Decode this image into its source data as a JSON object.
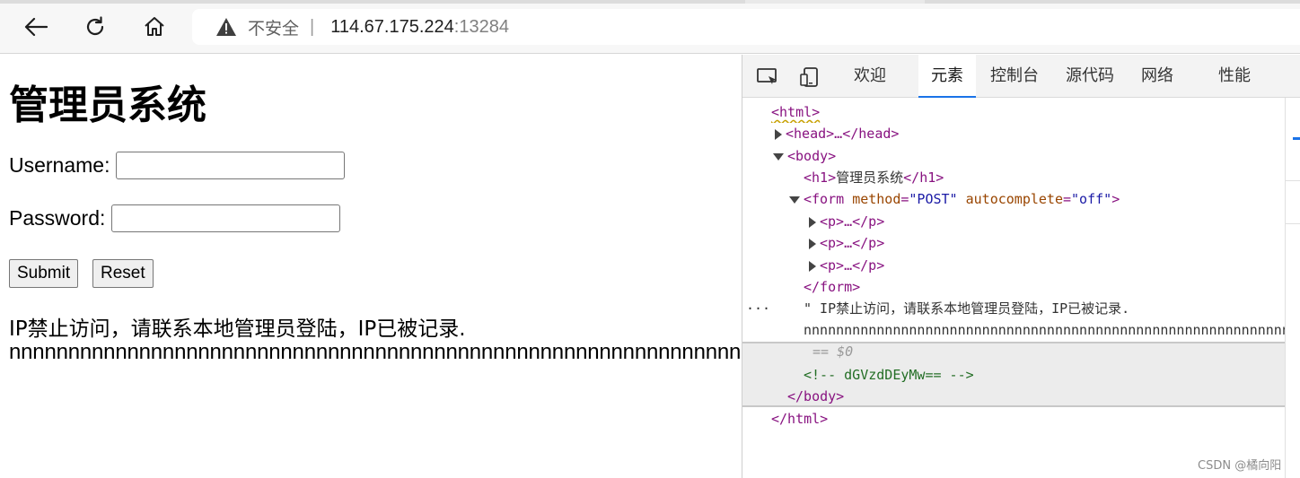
{
  "browser": {
    "insecure_label": "不安全",
    "separator": "|",
    "url_host": "114.67.175.224",
    "url_port": ":13284"
  },
  "page": {
    "heading": "管理员系统",
    "username_label": "Username:",
    "password_label": "Password:",
    "submit_label": "Submit",
    "reset_label": "Reset",
    "message": "IP禁止访问，请联系本地管理员登陆，IP已被记录.",
    "n_line": "nnnnnnnnnnnnnnnnnnnnnnnnnnnnnnnnnnnnnnnnnnnnnnnnnnnnnnnnnnnnnnnnnnnnnnnnnnnnnnnnnnnnnnnnnnnnnnnnnnnnnnnnnnnnnnnnnnnnn"
  },
  "devtools": {
    "tabs": [
      "欢迎",
      "元素",
      "控制台",
      "源代码",
      "网络",
      "性能"
    ],
    "active_tab": "元素",
    "tree": {
      "html_open": "<html>",
      "head": "<head>…</head>",
      "body_open": "<body>",
      "h1_open": "<h1>",
      "h1_text": "管理员系统",
      "h1_close": "</h1>",
      "form_tag_open": "<form",
      "attr_method": "method",
      "val_method": "\"POST\"",
      "attr_autocomplete": "autocomplete",
      "val_autocomplete": "\"off\"",
      "form_tag_end": ">",
      "p_collapsed": "<p>…</p>",
      "form_close": "</form>",
      "dots": "···",
      "text_node": "\" IP禁止访问，请联系本地管理员登陆，IP已被记录.",
      "text_node_n": "nnnnnnnnnnnnnnnnnnnnnnnnnnnnnnnnnnnnnnnnnnnnnnnnnnnnnnnnnnnnnnnnnnnnnnnnnnnnnnnnnnnnnnnnnnnnnnnnnn",
      "eq_marker": "== $0",
      "comment": "<!-- dGVzdDEyMw== -->",
      "body_close": "</body>",
      "html_close": "</html>"
    }
  },
  "watermark": "CSDN @橘向阳",
  "colors": {
    "accent_blue": "#1a73e8",
    "tag_purple": "#881280",
    "attr_brown": "#994500",
    "value_blue": "#1a1aa6",
    "comment_green": "#236e25"
  }
}
